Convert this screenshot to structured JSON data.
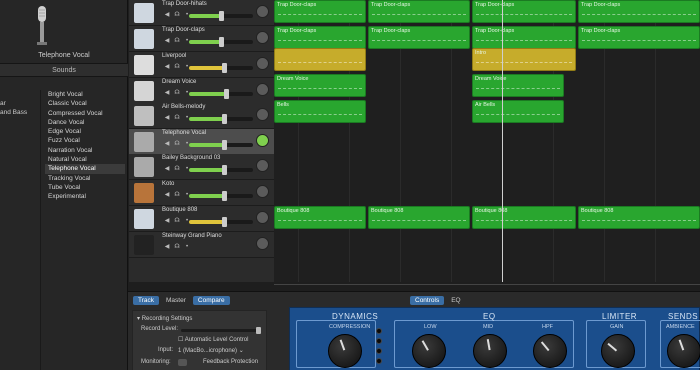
{
  "library": {
    "patch_name": "Telephone Vocal",
    "sounds_label": "Sounds",
    "categories": [
      "ar",
      "and Bass"
    ],
    "patches": [
      "Bright Vocal",
      "Classic Vocal",
      "Compressed Vocal",
      "Dance Vocal",
      "Edge Vocal",
      "Fuzz Vocal",
      "Narration Vocal",
      "Natural Vocal",
      "Telephone Vocal",
      "Tracking Vocal",
      "Tube Vocal",
      "Experimental"
    ],
    "selected_index": 8
  },
  "tracks": [
    {
      "name": "Trap Door-hihats",
      "fill": 0.5,
      "icon": "drum-machine-icon"
    },
    {
      "name": "Trap Door-claps",
      "fill": 0.5,
      "icon": "drum-machine-icon"
    },
    {
      "name": "Liverpool",
      "fill": 0.55,
      "icon": "drummer-icon"
    },
    {
      "name": "Dream Voice",
      "fill": 0.58,
      "icon": "synth-icon"
    },
    {
      "name": "Air Bells-melody",
      "fill": 0.55,
      "icon": "synth-keys-icon"
    },
    {
      "name": "Telephone Vocal",
      "fill": 0.55,
      "icon": "microphone-icon"
    },
    {
      "name": "Bailey Background 03",
      "fill": 0.55,
      "icon": "microphone-icon"
    },
    {
      "name": "Koto",
      "fill": 0.55,
      "icon": "koto-icon"
    },
    {
      "name": "Boutique 808",
      "fill": 0.55,
      "icon": "drum-machine-icon"
    },
    {
      "name": "Steinway Grand Piano",
      "fill": 0,
      "icon": "piano-icon"
    }
  ],
  "regions": [
    {
      "name": "Trap Door-claps"
    },
    {
      "name": "Trap Door-claps"
    },
    {
      "name": "Trap Door-claps"
    },
    {
      "name": "Trap Door-claps"
    },
    {
      "name": "Trap Door-claps"
    },
    {
      "name": "Trap Door-claps"
    },
    {
      "name": "Trap Door-claps"
    },
    {
      "name": "Trap Door-claps"
    },
    {
      "name": ""
    },
    {
      "name": "Intro"
    },
    {
      "name": "Dream Voice"
    },
    {
      "name": "Dream Voice"
    },
    {
      "name": "Bells"
    },
    {
      "name": "Air Bells"
    },
    {
      "name": "Boutique 808"
    },
    {
      "name": "Boutique 808"
    },
    {
      "name": "Boutique 808"
    },
    {
      "name": "Boutique 808"
    }
  ],
  "bottom": {
    "tabs": [
      "Track",
      "Master",
      "Compare"
    ],
    "ctrl_tabs": [
      "Controls",
      "EQ"
    ],
    "rec_title": "Recording Settings",
    "record_level": "Record Level:",
    "auto_level": "Automatic Level Control",
    "input_label": "Input:",
    "input_value": "1 (MacBo...icrophone)",
    "monitoring_label": "Monitoring:",
    "feedback": "Feedback Protection"
  },
  "panel": {
    "dynamics": "DYNAMICS",
    "eq": "EQ",
    "limiter": "LIMITER",
    "sends": "SENDS",
    "compression": "COMPRESSION",
    "low": "LOW",
    "mid": "MID",
    "hpf": "HPF",
    "gain": "GAIN",
    "ambience": "AMBIENCE"
  }
}
